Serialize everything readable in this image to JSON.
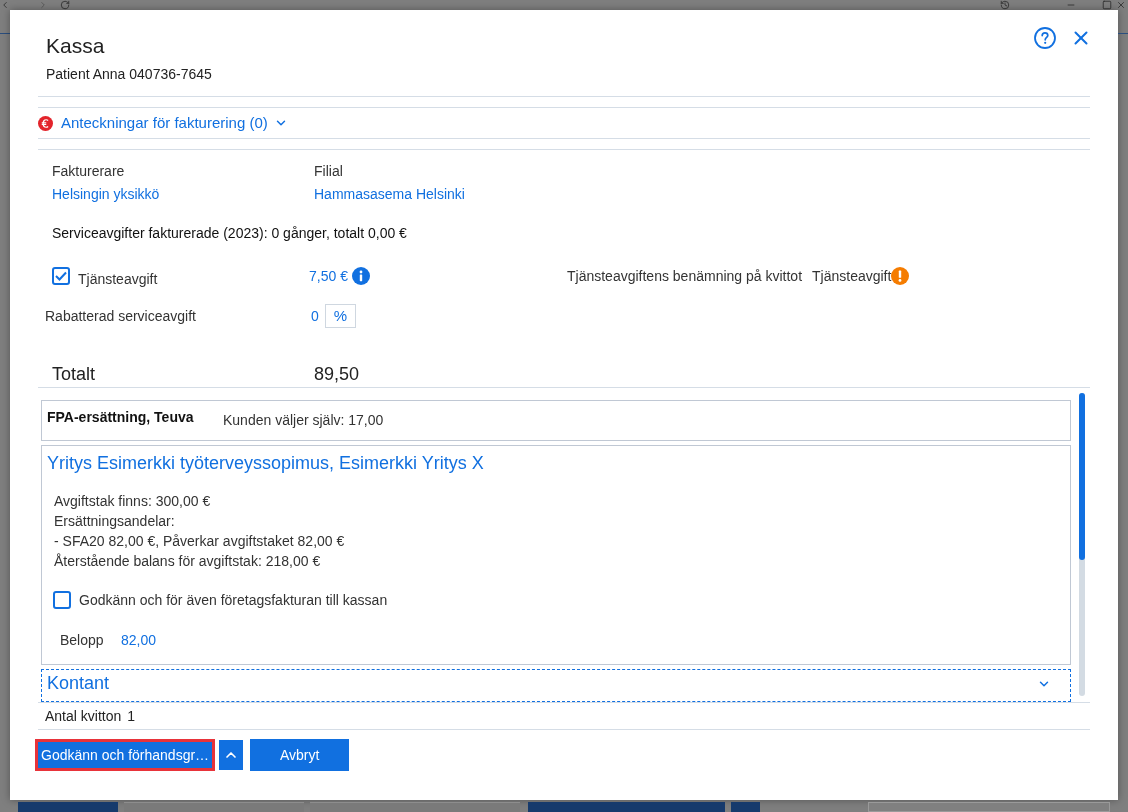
{
  "dialog": {
    "title": "Kassa",
    "subtitle": "Patient Anna 040736-7645"
  },
  "billing_notes": {
    "label": "Anteckningar för fakturering (0)",
    "expanded": false
  },
  "billing": [
    {
      "label": "Fakturerare",
      "value": "Helsingin yksikkö"
    },
    {
      "label": "Filial",
      "value": "Hammasasema Helsinki"
    }
  ],
  "service_fee_summary": "Serviceavgifter fakturerade (2023): 0 gånger, totalt 0,00 €",
  "service_fee": {
    "label": "Tjänsteavgift",
    "checked": true,
    "amount": "7,50 €",
    "receipt_name_label": "Tjänsteavgiftens benämning på kvittot",
    "receipt_name": "Tjänsteavgift"
  },
  "discount": {
    "label": "Rabatterad serviceavgift",
    "value": "0",
    "unit": "%"
  },
  "total": {
    "label": "Totalt",
    "value": "89,50"
  },
  "payers": [
    {
      "kind": "benefit",
      "title": "FPA-ersättning, Teuva",
      "detail": "Kunden väljer själv: 17,00"
    },
    {
      "kind": "contract",
      "title": "Yritys Esimerkki työterveyssopimus, Esimerkki Yritys X",
      "lines": [
        "Avgiftstak finns: 300,00 €",
        "Ersättningsandelar:",
        "- SFA20 82,00 €, Påverkar avgiftstaket 82,00 €",
        "Återstående balans för avgiftstak: 218,00 €"
      ],
      "approve": {
        "label": "Godkänn och för även företagsfakturan till kassan",
        "checked": false
      },
      "amount_label": "Belopp",
      "amount": "82,00"
    },
    {
      "kind": "section",
      "title": "Kontant",
      "expanded": false,
      "focused": true
    }
  ],
  "receipt_count": {
    "label": "Antal kvitton",
    "value": "1"
  },
  "buttons": [
    {
      "kind": "split",
      "label": "Godkänn och förhandsgr…",
      "highlighted": true
    },
    {
      "kind": "plain",
      "label": "Avbryt",
      "highlighted": false
    }
  ]
}
